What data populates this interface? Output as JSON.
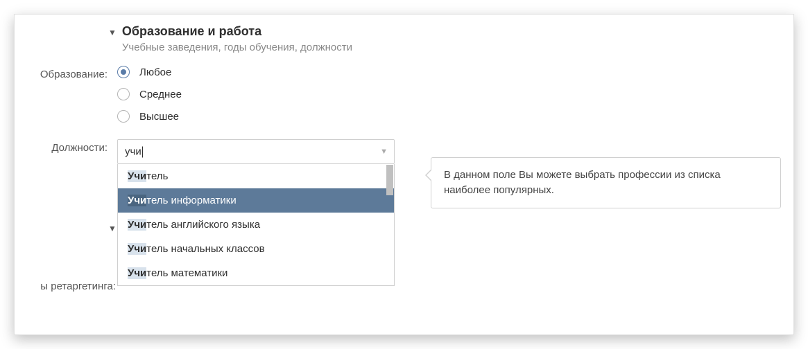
{
  "section": {
    "title": "Образование и работа",
    "subtitle": "Учебные заведения, годы обучения, должности"
  },
  "education": {
    "label": "Образование:",
    "options": {
      "any": "Любое",
      "secondary": "Среднее",
      "higher": "Высшее"
    }
  },
  "positions": {
    "label": "Должности:",
    "input_value": "учи",
    "suggestions": [
      {
        "match": "Учи",
        "rest": "тель"
      },
      {
        "match": "Учи",
        "rest": "тель информатики"
      },
      {
        "match": "Учи",
        "rest": "тель английского языка"
      },
      {
        "match": "Учи",
        "rest": "тель начальных классов"
      },
      {
        "match": "Учи",
        "rest": "тель математики"
      }
    ]
  },
  "tooltip": "В данном поле Вы можете выбрать профессии из списка наиболее популярных.",
  "retarget_label": "ы ретаргетинга:"
}
